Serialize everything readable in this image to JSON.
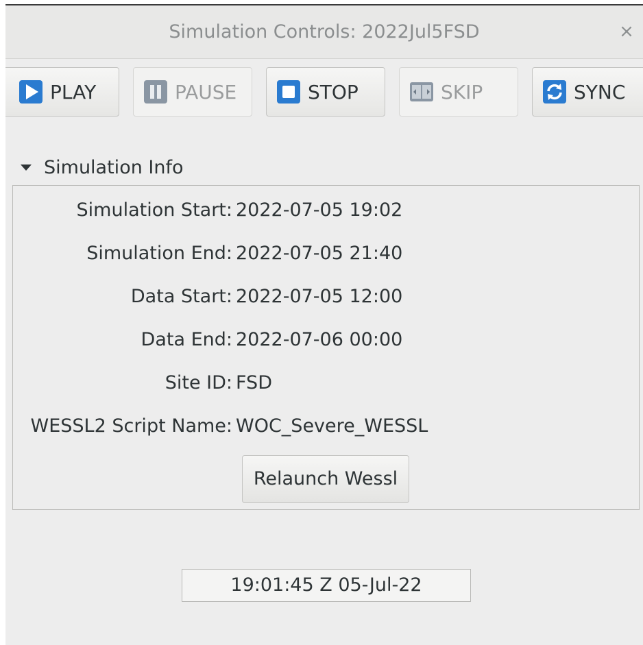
{
  "window": {
    "title": "Simulation Controls: 2022Jul5FSD",
    "close_glyph": "×"
  },
  "toolbar": {
    "buttons": [
      {
        "label": "PLAY",
        "icon": "play-icon",
        "enabled": true,
        "color": "#2a7bd0"
      },
      {
        "label": "PAUSE",
        "icon": "pause-icon",
        "enabled": false,
        "color": "#8a96a3"
      },
      {
        "label": "STOP",
        "icon": "stop-icon",
        "enabled": true,
        "color": "#2a7bd0"
      },
      {
        "label": "SKIP",
        "icon": "skip-icon",
        "enabled": false,
        "color": "#8a96a3"
      },
      {
        "label": "SYNC",
        "icon": "sync-icon",
        "enabled": true,
        "color": "#2a7bd0"
      }
    ]
  },
  "info": {
    "header": "Simulation Info",
    "expanded": true,
    "rows": [
      {
        "label": "Simulation Start:",
        "value": "2022-07-05 19:02"
      },
      {
        "label": "Simulation End:",
        "value": "2022-07-05 21:40"
      },
      {
        "label": "Data Start:",
        "value": "2022-07-05 12:00"
      },
      {
        "label": "Data End:",
        "value": "2022-07-06 00:00"
      },
      {
        "label": "Site ID:",
        "value": "FSD"
      },
      {
        "label": "WESSL2 Script Name:",
        "value": "WOC_Severe_WESSL"
      }
    ],
    "relaunch_label": "Relaunch Wessl"
  },
  "clock": {
    "value": "19:01:45 Z 05-Jul-22"
  }
}
